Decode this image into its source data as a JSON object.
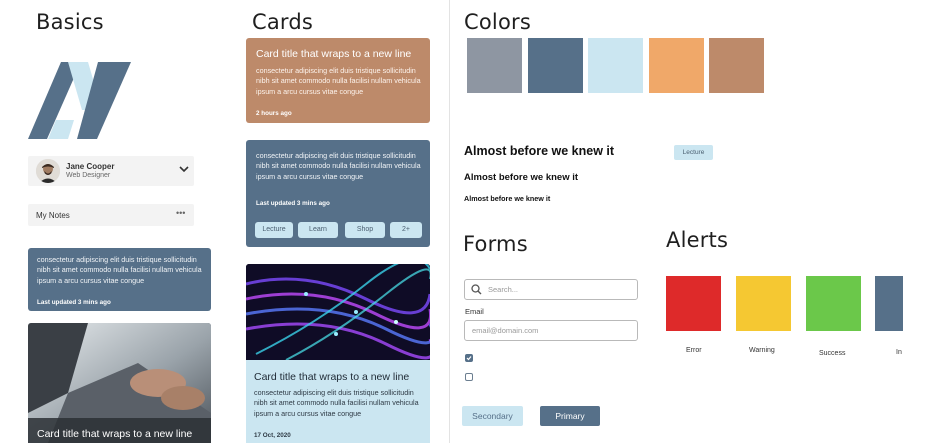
{
  "sections": {
    "basics": "Basics",
    "cards": "Cards",
    "colors": "Colors",
    "forms": "Forms",
    "alerts": "Alerts"
  },
  "profile": {
    "name": "Jane Cooper",
    "role": "Web Designer"
  },
  "notes": {
    "label": "My Notes",
    "menu": "•••"
  },
  "left_card": {
    "body": "consectetur adipiscing elit duis tristique sollicitudin nibh sit amet commodo nulla facilisi nullam vehicula ipsum a arcu cursus vitae congue",
    "meta": "Last updated 3 mins ago"
  },
  "left_image_card": {
    "title": "Card title that wraps to a new line"
  },
  "cards": {
    "card1": {
      "title": "Card title that wraps to a new line",
      "body": "consectetur adipiscing elit duis tristique sollicitudin nibh sit amet commodo nulla facilisi nullam vehicula ipsum a arcu cursus vitae congue",
      "meta": "2 hours ago"
    },
    "card2": {
      "body": "consectetur adipiscing elit duis tristique sollicitudin nibh sit amet commodo nulla facilisi nullam vehicula ipsum a arcu cursus vitae congue",
      "meta": "Last updated 3 mins ago",
      "actions": [
        "Lecture",
        "Learn",
        "Shop",
        "2+"
      ]
    },
    "card3": {
      "title": "Card title that wraps to a new line",
      "body": "consectetur adipiscing elit duis tristique sollicitudin nibh sit amet commodo nulla facilisi nullam vehicula ipsum a arcu cursus vitae congue",
      "meta": "17 Oct, 2020"
    }
  },
  "colors": [
    "#8e96a2",
    "#567089",
    "#cbe6f1",
    "#f0a869",
    "#bd8a6a"
  ],
  "headings": {
    "h1": "Almost before we knew it",
    "h2": "Almost before we knew it",
    "h3": "Almost before we knew it",
    "tag": "Lecture"
  },
  "forms": {
    "search_placeholder": "Search...",
    "email_label": "Email",
    "email_placeholder": "email@domain.com",
    "checkbox1_checked": true,
    "checkbox2_checked": false,
    "secondary": "Secondary",
    "primary": "Primary"
  },
  "alerts": {
    "error": {
      "label": "Error",
      "color": "#de2a2a"
    },
    "warning": {
      "label": "Warning",
      "color": "#f5c832"
    },
    "success": {
      "label": "Success",
      "color": "#6bc84a"
    },
    "info": {
      "label": "In",
      "color": "#567089"
    }
  }
}
